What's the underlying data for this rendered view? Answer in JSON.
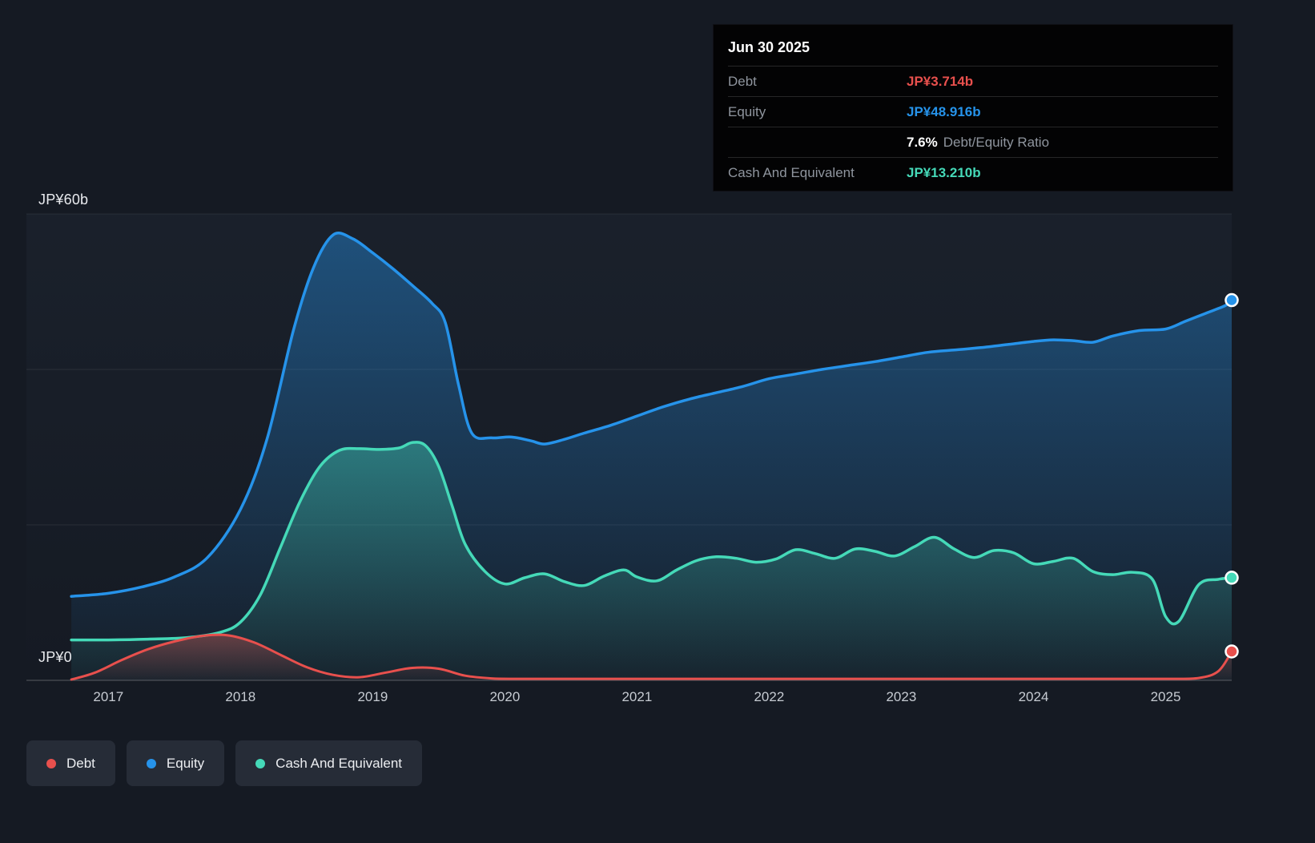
{
  "colors": {
    "debt": "#e8504d",
    "equity": "#2693ea",
    "cash": "#45d9b8"
  },
  "tooltip": {
    "date": "Jun 30 2025",
    "debt_label": "Debt",
    "debt_value": "JP¥3.714b",
    "equity_label": "Equity",
    "equity_value": "JP¥48.916b",
    "ratio_value": "7.6%",
    "ratio_label": "Debt/Equity Ratio",
    "cash_label": "Cash And Equivalent",
    "cash_value": "JP¥13.210b"
  },
  "legend": [
    {
      "label": "Debt",
      "color": "#e8504d"
    },
    {
      "label": "Equity",
      "color": "#2693ea"
    },
    {
      "label": "Cash And Equivalent",
      "color": "#45d9b8"
    }
  ],
  "chart_data": {
    "type": "area",
    "title": "",
    "units": "JP¥ billions",
    "x_axis": {
      "tick_labels": [
        "2017",
        "2018",
        "2019",
        "2020",
        "2021",
        "2022",
        "2023",
        "2024",
        "2025"
      ],
      "tick_values": [
        2017,
        2018,
        2019,
        2020,
        2021,
        2022,
        2023,
        2024,
        2025
      ],
      "range": [
        2016.38,
        2025.5
      ]
    },
    "y_axis": {
      "label_top": "JP¥60b",
      "label_zero": "JP¥0",
      "range": [
        0,
        60
      ],
      "gridline_values": [
        20,
        40,
        60
      ],
      "baseline": 0
    },
    "series": [
      {
        "name": "Equity",
        "color": "#2693ea",
        "stroke_width": 3.5,
        "end_value": 48.916,
        "x": [
          2016.72,
          2017.0,
          2017.25,
          2017.5,
          2017.75,
          2018.0,
          2018.2,
          2018.4,
          2018.55,
          2018.7,
          2018.85,
          2019.0,
          2019.15,
          2019.3,
          2019.45,
          2019.55,
          2019.65,
          2019.75,
          2019.9,
          2020.05,
          2020.2,
          2020.3,
          2020.45,
          2020.6,
          2020.8,
          2021.0,
          2021.2,
          2021.4,
          2021.6,
          2021.8,
          2022.0,
          2022.2,
          2022.4,
          2022.6,
          2022.8,
          2023.0,
          2023.2,
          2023.4,
          2023.6,
          2023.8,
          2024.0,
          2024.15,
          2024.3,
          2024.45,
          2024.6,
          2024.8,
          2025.0,
          2025.15,
          2025.3,
          2025.45,
          2025.5
        ],
        "values": [
          10.8,
          11.2,
          12.0,
          13.3,
          15.8,
          22.0,
          31.0,
          45.0,
          53.0,
          57.3,
          56.8,
          55.0,
          53.0,
          50.8,
          48.5,
          46.0,
          38.0,
          31.8,
          31.2,
          31.3,
          30.8,
          30.4,
          31.0,
          31.8,
          32.8,
          34.0,
          35.2,
          36.2,
          37.0,
          37.8,
          38.8,
          39.4,
          40.0,
          40.5,
          41.0,
          41.6,
          42.2,
          42.5,
          42.8,
          43.2,
          43.6,
          43.8,
          43.7,
          43.5,
          44.3,
          45.0,
          45.2,
          46.2,
          47.2,
          48.2,
          48.916
        ]
      },
      {
        "name": "Cash And Equivalent",
        "color": "#45d9b8",
        "stroke_width": 3.5,
        "end_value": 13.21,
        "x": [
          2016.72,
          2017.0,
          2017.3,
          2017.6,
          2017.85,
          2018.0,
          2018.15,
          2018.3,
          2018.45,
          2018.6,
          2018.75,
          2018.9,
          2019.05,
          2019.2,
          2019.3,
          2019.4,
          2019.5,
          2019.6,
          2019.7,
          2019.85,
          2020.0,
          2020.15,
          2020.3,
          2020.45,
          2020.6,
          2020.75,
          2020.9,
          2021.0,
          2021.15,
          2021.3,
          2021.45,
          2021.6,
          2021.75,
          2021.9,
          2022.05,
          2022.2,
          2022.35,
          2022.5,
          2022.65,
          2022.8,
          2022.95,
          2023.1,
          2023.25,
          2023.4,
          2023.55,
          2023.7,
          2023.85,
          2024.0,
          2024.15,
          2024.3,
          2024.45,
          2024.6,
          2024.75,
          2024.9,
          2025.0,
          2025.1,
          2025.25,
          2025.4,
          2025.5
        ],
        "values": [
          5.2,
          5.2,
          5.3,
          5.5,
          6.2,
          7.5,
          11.0,
          17.0,
          23.0,
          27.5,
          29.6,
          29.8,
          29.7,
          29.9,
          30.6,
          30.2,
          27.5,
          22.5,
          17.5,
          14.0,
          12.4,
          13.2,
          13.7,
          12.7,
          12.2,
          13.4,
          14.2,
          13.3,
          12.8,
          14.2,
          15.4,
          15.9,
          15.7,
          15.2,
          15.6,
          16.8,
          16.3,
          15.7,
          16.9,
          16.6,
          16.0,
          17.2,
          18.4,
          16.9,
          15.8,
          16.7,
          16.4,
          15.0,
          15.3,
          15.7,
          14.0,
          13.6,
          13.9,
          13.0,
          8.2,
          7.6,
          12.3,
          13.0,
          13.21
        ]
      },
      {
        "name": "Debt",
        "color": "#e8504d",
        "stroke_width": 3,
        "end_value": 3.714,
        "x": [
          2016.72,
          2016.9,
          2017.1,
          2017.3,
          2017.5,
          2017.7,
          2017.9,
          2018.1,
          2018.3,
          2018.5,
          2018.7,
          2018.9,
          2019.1,
          2019.3,
          2019.5,
          2019.7,
          2019.9,
          2020.1,
          2020.5,
          2021.0,
          2021.5,
          2022.0,
          2022.5,
          2023.0,
          2023.5,
          2024.0,
          2024.5,
          2025.0,
          2025.25,
          2025.4,
          2025.5
        ],
        "values": [
          0.1,
          1.0,
          2.6,
          4.0,
          5.0,
          5.7,
          5.8,
          4.9,
          3.3,
          1.7,
          0.7,
          0.4,
          1.0,
          1.6,
          1.5,
          0.6,
          0.25,
          0.2,
          0.2,
          0.2,
          0.2,
          0.2,
          0.2,
          0.2,
          0.2,
          0.2,
          0.2,
          0.2,
          0.3,
          1.2,
          3.714
        ]
      }
    ]
  }
}
